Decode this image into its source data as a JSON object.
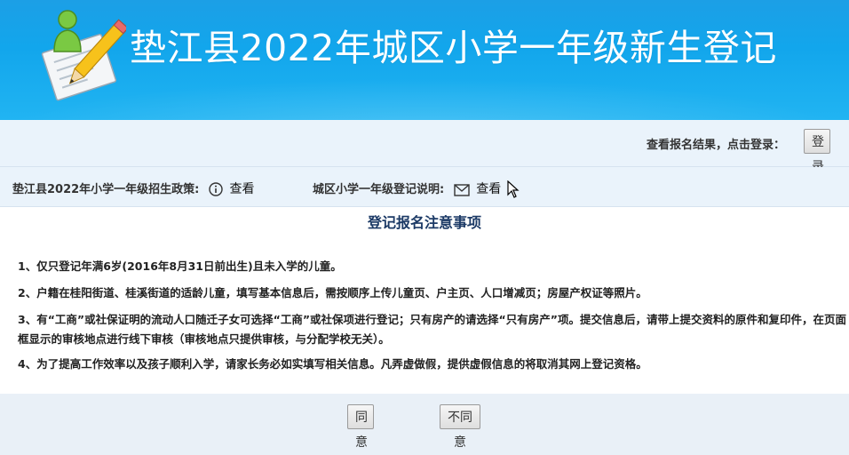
{
  "header": {
    "title": "垫江县2022年城区小学一年级新生登记"
  },
  "login": {
    "prompt": "查看报名结果，点击登录：",
    "button_label": "登 录"
  },
  "policy": {
    "left_label": "垫江县2022年小学一年级招生政策:",
    "left_link": "查看",
    "right_label": "城区小学一年级登记说明:",
    "right_link": "查看"
  },
  "notice": {
    "title": "登记报名注意事项",
    "items": [
      "1、仅只登记年满6岁(2016年8月31日前出生)且未入学的儿童。",
      "2、户籍在桂阳街道、桂溪街道的适龄儿童，填写基本信息后，需按顺序上传儿童页、户主页、人口增减页；房屋产权证等照片。",
      "3、有“工商”或社保证明的流动人口随迁子女可选择“工商”或社保项进行登记；只有房产的请选择“只有房产”项。提交信息后，请带上提交资料的原件和复印件，在页面框显示的审核地点进行线下审核（审核地点只提供审核，与分配学校无关）。",
      "4、为了提高工作效率以及孩子顺利入学，请家长务必如实填写相关信息。凡弄虚做假，提供虚假信息的将取消其网上登记资格。"
    ]
  },
  "actions": {
    "agree_label": "同意",
    "disagree_label": "不同意"
  },
  "colors": {
    "header_blue": "#12a6ec",
    "bar_bg": "#eaf3fb",
    "title_navy": "#1c3a66"
  },
  "icons": {
    "logo": "registration-form-pencil-icon",
    "policy_view": "info-circle-icon",
    "explain_view": "envelope-icon",
    "pointer": "mouse-cursor-icon"
  }
}
